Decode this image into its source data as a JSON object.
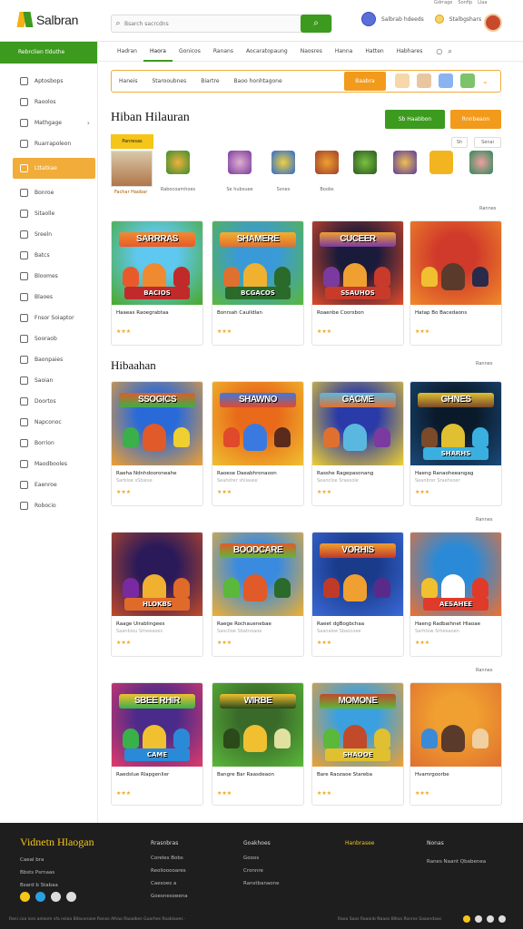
{
  "header": {
    "logo_text": "Salbran",
    "search_placeholder": "Bsarch sacrcdns",
    "top_links": [
      "Gdrrage",
      "Sonfip",
      "Llaa"
    ],
    "user_label": "Salbrab hdeeds",
    "user2_label": "Stalbgshars",
    "colors": {
      "green": "#3c9a1e",
      "orange": "#f29a1b",
      "yellow": "#f5c518"
    }
  },
  "sidebar": {
    "header": "Rebrclien tlduthe",
    "items": [
      {
        "label": "Aptosbops",
        "icon": "pencil-icon"
      },
      {
        "label": "Raoolos",
        "icon": "puzzle-icon"
      },
      {
        "label": "Mathgage",
        "icon": "grid-icon",
        "chevron": true
      },
      {
        "label": "Ruarrapoleon",
        "icon": "monitor-icon"
      },
      {
        "label": "Lttatkae",
        "icon": "star-icon",
        "active": true
      },
      {
        "label": "Bonroe",
        "icon": "box-icon"
      },
      {
        "label": "Sitaolle",
        "icon": "book-icon"
      },
      {
        "label": "Sreeln",
        "icon": "check-icon"
      },
      {
        "label": "Batcs",
        "icon": "flag-icon"
      },
      {
        "label": "Bloomes",
        "icon": "play-icon"
      },
      {
        "label": "Blaoes",
        "icon": "folder-icon"
      },
      {
        "label": "Fnsor Soiaptor",
        "icon": "heart-icon"
      },
      {
        "label": "Sooraob",
        "icon": "diamond-icon"
      },
      {
        "label": "Baonpaies",
        "icon": "cart-icon"
      },
      {
        "label": "Saoian",
        "icon": "edit-icon"
      },
      {
        "label": "Doortos",
        "icon": "clock-icon"
      },
      {
        "label": "Napconoc",
        "icon": "calendar-icon"
      },
      {
        "label": "Borrion",
        "icon": "music-icon"
      },
      {
        "label": "Maodbooles",
        "icon": "layers-icon"
      },
      {
        "label": "Eaenroe",
        "icon": "share-icon"
      },
      {
        "label": "Robocio",
        "icon": "trophy-icon"
      }
    ]
  },
  "nav": {
    "tabs": [
      "Hadran",
      "Haora",
      "Gonicos",
      "Ranans",
      "Aocaratopaung",
      "Naosres",
      "Hanna",
      "Hatten",
      "Habhares"
    ],
    "active_index": 1
  },
  "filter": {
    "labels": [
      "Haneis",
      "Starooubnes",
      "Biartre",
      "Baoo honhtagone"
    ],
    "button": "Baabra"
  },
  "main": {
    "section1_title": "Hiban Hilauran",
    "btn_green": "Sb Haabbon",
    "btn_orange": "Rnnbeaon",
    "badge": "Panresas",
    "ctrl_a": "Sh",
    "ctrl_b": "Senai",
    "feature_main_label": "Fachar Haobar",
    "feature_labels": [
      "Rabocoamhoes",
      "Se hubsuee",
      "Ssnes",
      "Boobs"
    ],
    "more1": "Rannes",
    "section2_title": "Hibaahan",
    "more2": "Rannes",
    "more3": "Rannes",
    "more4": "Rannes"
  },
  "cards": [
    {
      "title": "Haaeas Raoegrabtaa",
      "sub": "",
      "banner": "SARRRAS",
      "plate": "BACIOS",
      "rating": "★★★"
    },
    {
      "title": "Bonrsah Caulldlan",
      "sub": "",
      "banner": "SHAMERE",
      "plate": "BCGACOS",
      "rating": "★★★"
    },
    {
      "title": "Roaenbe Coorsbon",
      "sub": "",
      "banner": "CUCEER",
      "plate": "SSAUHOS",
      "rating": "★★★"
    },
    {
      "title": "Hatap Bo Bacedaons",
      "sub": "",
      "banner": "",
      "plate": "",
      "rating": "★★★"
    },
    {
      "title": "Raeha Ndnhdooroneahe",
      "sub": "Sarbloe sSbiese",
      "banner": "SSOGICS",
      "plate": "",
      "rating": "★★★"
    },
    {
      "title": "Raoese Daeabhronaoon",
      "sub": "Seahdrer shliasee",
      "banner": "SHAWNO",
      "plate": "",
      "rating": "★★★"
    },
    {
      "title": "Rasshe Ragepasonang",
      "sub": "Seancloe Sraesole",
      "banner": "GACME",
      "plate": "",
      "rating": "★★★"
    },
    {
      "title": "Haeng Ranaoheeangag",
      "sub": "Seanbrer Sraehsoer",
      "banner": "GHNES",
      "plate": "SHARHS",
      "rating": "★★★"
    },
    {
      "title": "Raage Uirablingees",
      "sub": "Saanbiou Srheeaoes",
      "banner": "",
      "plate": "HLOKBS",
      "rating": "★★★"
    },
    {
      "title": "Raege Rochauenebae",
      "sub": "Saoclloe Sbatnoaoe",
      "banner": "BOODCARE",
      "plate": "",
      "rating": "★★★"
    },
    {
      "title": "Raeet dgBogbchaa",
      "sub": "Saanaloe Sbascoee",
      "banner": "VORHIS",
      "plate": "",
      "rating": "★★★"
    },
    {
      "title": "Haeng Radbaihnet Hlaoae",
      "sub": "Sarhtow Srheeaoen",
      "banner": "",
      "plate": "AESAHEE",
      "rating": "★★★"
    },
    {
      "title": "Raedslue Rlapgenlier",
      "sub": "",
      "banner": "SBEE RHIR",
      "plate": "CAME",
      "rating": "★★★"
    },
    {
      "title": "Bangre Bar Raasdeaon",
      "sub": "",
      "banner": "WIRBE",
      "plate": "",
      "rating": "★★★"
    },
    {
      "title": "Bare Raozaoe Stareba",
      "sub": "",
      "banner": "MOMONE",
      "plate": "SHAOOE",
      "rating": "★★★"
    },
    {
      "title": "Hvamrgoorbe",
      "sub": "",
      "banner": "",
      "plate": "",
      "rating": "★★★"
    }
  ],
  "footer": {
    "title": "Vidnetn Hlaogan",
    "left_links": [
      "Caeal bra",
      "Bbsts Psrnaas",
      "Bsard b Stabaa"
    ],
    "cols": [
      {
        "heading": "Rrasnbras",
        "links": [
          "Coreles Bobs",
          "Reoliooooares",
          "Caesoes a",
          "Goesnesoeena"
        ]
      },
      {
        "heading": "Goakhoes",
        "links": [
          "Gooos",
          "Cronnre",
          "Ranstbanaone"
        ]
      },
      {
        "heading": "Hanbrasee",
        "links": []
      },
      {
        "heading": "Nonas",
        "links": [
          "Ranes Naant Qbabenea"
        ]
      }
    ],
    "bottom_left": "Rani coa loro aeloom vfa nsloa Bllavonaee Ranos Alhao Raoalbes Guorhes Roablaoes ·",
    "bottom_right": "Raoa Saos Raaonb  Naaos  Bllloa Ronros  Saaondaas"
  }
}
